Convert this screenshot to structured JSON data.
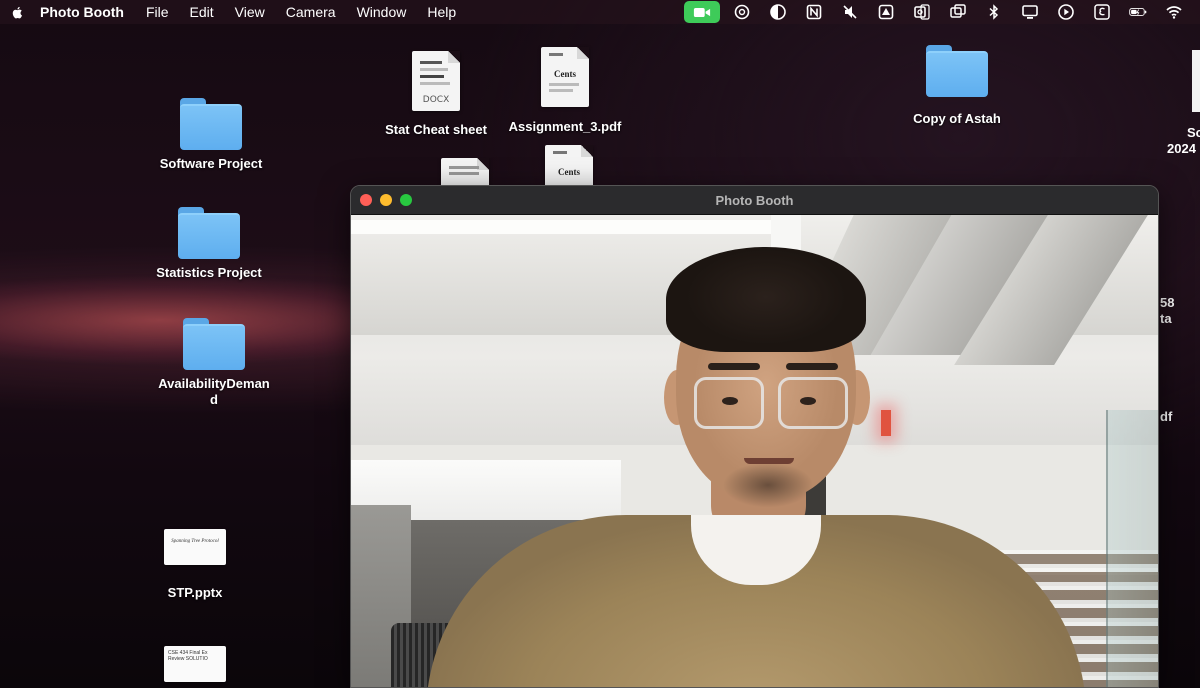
{
  "menubar": {
    "app_name": "Photo Booth",
    "menus": [
      "File",
      "Edit",
      "View",
      "Camera",
      "Window",
      "Help"
    ],
    "status_icons": [
      "camera-in-use-icon",
      "chatgpt-icon",
      "contrast-icon",
      "notion-icon",
      "mute-icon",
      "drive-icon",
      "outlook-icon",
      "screen-mirror-icon",
      "bluetooth-icon",
      "display-icon",
      "play-icon",
      "keyboard-input-icon",
      "battery-icon",
      "wifi-icon"
    ],
    "colors": {
      "camera_pill": "#3ecb59"
    }
  },
  "desktop": {
    "items": [
      {
        "label": "Software Project",
        "kind": "folder"
      },
      {
        "label": "Statistics Project",
        "kind": "folder"
      },
      {
        "label": "AvailabilityDeman d",
        "kind": "folder"
      },
      {
        "label": "STP.pptx",
        "kind": "slide",
        "preview_text": "Spanning Tree Protocol"
      },
      {
        "label": "Stat Cheat sheet",
        "kind": "document",
        "preview_tag": "DOCX"
      },
      {
        "label": "Assignment_3.pdf",
        "kind": "document",
        "preview_title": "Cents"
      },
      {
        "label": "Copy of Astah",
        "kind": "folder"
      }
    ],
    "partial_items": {
      "doc_preview_title": "Cents",
      "slide_preview_text": "CSE 434 Final Ex Review SOLUTIO",
      "right_edge_labels": [
        "Sc",
        "2024",
        "58",
        "ta",
        "df"
      ]
    }
  },
  "window": {
    "title": "Photo Booth",
    "traffic_lights": {
      "close": "#ff5f57",
      "minimize": "#febc2e",
      "zoom": "#28c840"
    }
  }
}
